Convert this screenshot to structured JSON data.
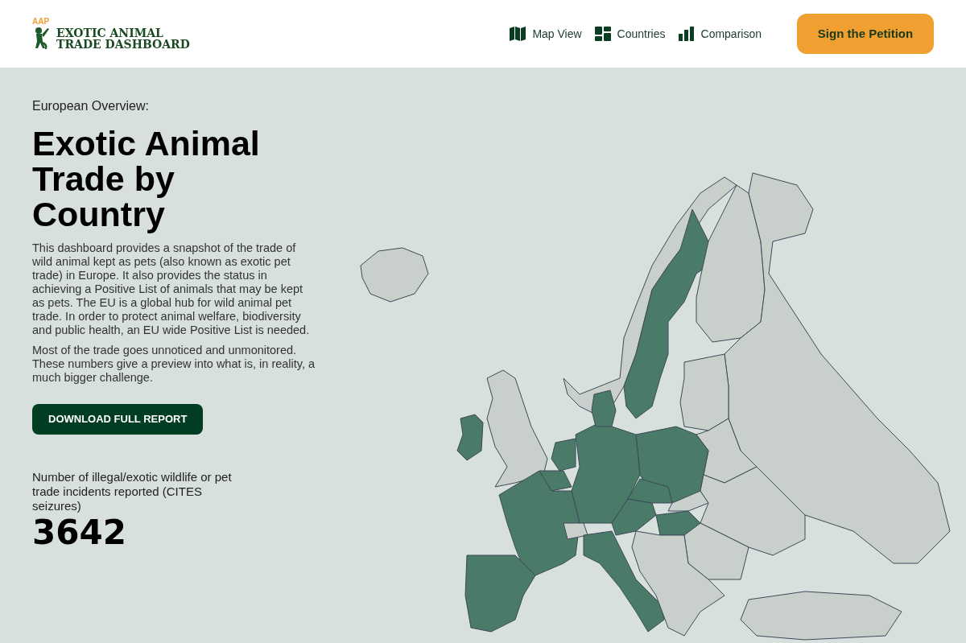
{
  "logo": {
    "badge": "AAP",
    "line_1": "EXOTIC ANIMAL",
    "line_2": "TRADE DASHBOARD"
  },
  "nav": [
    {
      "kind": "map",
      "label": "Map View"
    },
    {
      "kind": "grid",
      "label": "Countries"
    },
    {
      "kind": "bars",
      "label": "Comparison"
    }
  ],
  "cta_button": "Sign the Petition",
  "eyebrow": "European Overview:",
  "title": "Exotic Animal Trade by Country",
  "paragraphs": [
    "This dashboard provides a snapshot of the trade of wild animal kept as pets (also known as exotic pet trade) in Europe. It also provides the status in achieving a Positive List of animals that may be kept as pets. The EU is a global hub for wild animal pet trade. In order to protect animal welfare, biodiversity and public health, an EU wide Positive List is needed.",
    "Most of the trade goes unnoticed and unmonitored. These numbers give a preview into what is, in reality, a much bigger challenge."
  ],
  "download_button": "DOWNLOAD FULL REPORT",
  "stat": {
    "label": "Number of illegal/exotic wildlife or pet trade incidents reported (CITES seizures)",
    "value": "3642"
  },
  "map": {
    "regions": [
      {
        "highlighted": false
      },
      {
        "highlighted": true
      },
      {
        "highlighted": false
      },
      {
        "highlighted": false
      },
      {
        "highlighted": true
      },
      {
        "highlighted": false
      },
      {
        "highlighted": false
      },
      {
        "highlighted": false
      },
      {
        "highlighted": false
      },
      {
        "highlighted": true
      },
      {
        "highlighted": true
      },
      {
        "highlighted": true
      },
      {
        "highlighted": true
      },
      {
        "highlighted": true
      },
      {
        "highlighted": true
      },
      {
        "highlighted": true
      },
      {
        "highlighted": false
      },
      {
        "highlighted": true
      },
      {
        "highlighted": true
      },
      {
        "highlighted": true
      },
      {
        "highlighted": false
      },
      {
        "highlighted": true
      },
      {
        "highlighted": false
      },
      {
        "highlighted": false
      },
      {
        "highlighted": false
      },
      {
        "highlighted": false
      }
    ]
  }
}
